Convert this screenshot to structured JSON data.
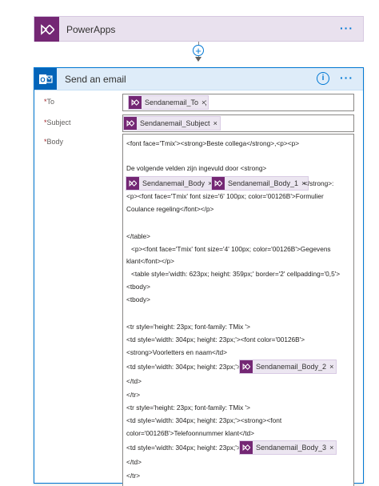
{
  "trigger": {
    "title": "PowerApps",
    "more_label": "···",
    "icon": "powerapps-icon",
    "accent_color": "#742774"
  },
  "connector": {
    "add_label": "+"
  },
  "action": {
    "title": "Send an email",
    "more_label": "···",
    "info_label": "i",
    "icon": "outlook-icon",
    "accent_color": "#0364b8",
    "fields": {
      "to": {
        "label": "To",
        "token": "Sendanemail_To",
        "suffix": ";"
      },
      "subject": {
        "label": "Subject",
        "token": "Sendanemail_Subject"
      },
      "body": {
        "label": "Body",
        "lines": [
          "<font face='Tmix'><strong>Beste collega</strong>,<p><p>",
          "De volgende velden zijn ingevuld door <strong>",
          "</strong>:",
          "<p><font face='Tmix' font size='6' 100px; color='00126B'>Formulier",
          "Coulance regeling</font></p>",
          "</table>",
          "<p><font face='Tmix' font size='4' 100px; color='00126B'>Gegevens",
          "klant</font></p>",
          "<table style='width: 623px; height: 359px;' border='2' cellpadding='0,5'>",
          "<tbody>",
          "<tbody>",
          "<tr style='height: 23px; font-family: TMix '>",
          "<td style='width: 304px; height: 23px;'><font color='00126B'>",
          "<strong>Voorletters en naam</td>",
          "<td style='width: 304px; height: 23px;'>",
          "</td>",
          "</tr>",
          "<tr style='height: 23px; font-family: TMix '>",
          "<td style='width: 304px; height: 23px;'><strong><font",
          "color='00126B'>Telefoonnummer klant</td>",
          "<td style='width: 304px; height: 23px;'>",
          "</td>",
          "</tr>"
        ],
        "tokens": {
          "body": "Sendanemail_Body",
          "body_1": "Sendanemail_Body_1",
          "body_2": "Sendanemail_Body_2",
          "body_3": "Sendanemail_Body_3"
        }
      }
    }
  },
  "token_remove_label": "×",
  "required_marker": "*"
}
